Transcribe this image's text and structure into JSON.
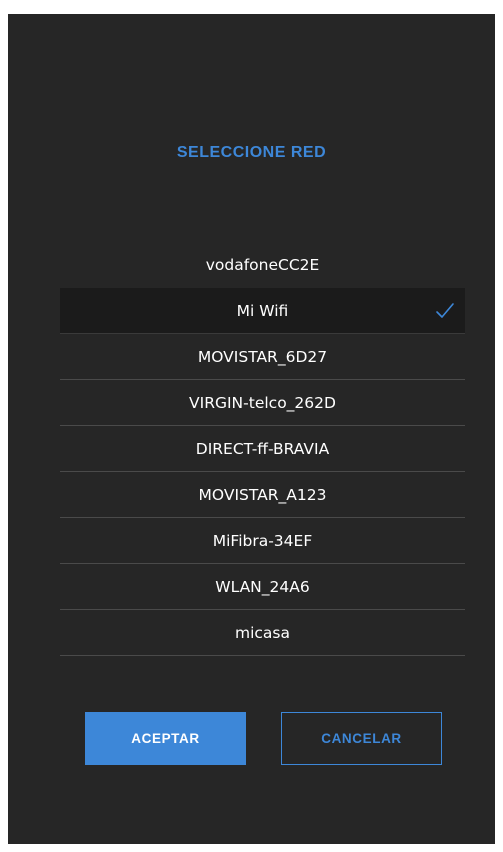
{
  "dialog": {
    "title": "SELECCIONE RED"
  },
  "networks": [
    {
      "name": "vodafoneCC2E",
      "selected": false
    },
    {
      "name": "Mi Wifi",
      "selected": true
    },
    {
      "name": "MOVISTAR_6D27",
      "selected": false
    },
    {
      "name": "VIRGIN-telco_262D",
      "selected": false
    },
    {
      "name": "DIRECT-ff-BRAVIA",
      "selected": false
    },
    {
      "name": "MOVISTAR_A123",
      "selected": false
    },
    {
      "name": "MiFibra-34EF",
      "selected": false
    },
    {
      "name": "WLAN_24A6",
      "selected": false
    },
    {
      "name": "micasa",
      "selected": false
    }
  ],
  "buttons": {
    "accept_label": "ACEPTAR",
    "cancel_label": "CANCELAR"
  },
  "colors": {
    "accent": "#3d87d8",
    "background": "#262626",
    "selected_row": "#1b1b1b"
  },
  "icons": {
    "selected_marker": "check-icon"
  }
}
